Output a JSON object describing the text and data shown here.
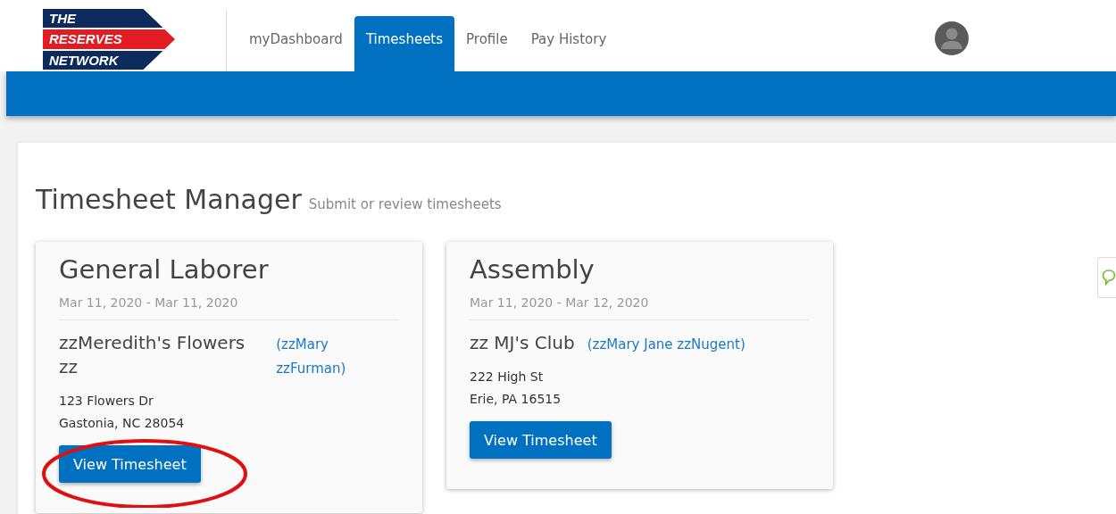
{
  "logo": {
    "lines": [
      "THE",
      "RESERVES",
      "NETWORK"
    ]
  },
  "nav": {
    "tabs": [
      {
        "label": "myDashboard",
        "selected": false
      },
      {
        "label": "Timesheets",
        "selected": true
      },
      {
        "label": "Profile",
        "selected": false
      },
      {
        "label": "Pay History",
        "selected": false
      }
    ]
  },
  "page": {
    "title": "Timesheet Manager",
    "subtitle": "Submit or review timesheets"
  },
  "cards": [
    {
      "title": "General Laborer",
      "dates": "Mar 11, 2020 - Mar 11, 2020",
      "company": "zzMeredith's Flowers zz",
      "contact": "(zzMary zzFurman)",
      "address": [
        "123 Flowers Dr",
        "Gastonia, NC 28054"
      ],
      "button": "View Timesheet",
      "highlighted": true
    },
    {
      "title": "Assembly",
      "dates": "Mar 11, 2020 - Mar 12, 2020",
      "company": "zz MJ's Club",
      "contact": "(zzMary Jane zzNugent)",
      "address": [
        "222 High St",
        "Erie, PA 16515"
      ],
      "button": "View Timesheet",
      "highlighted": false
    }
  ]
}
